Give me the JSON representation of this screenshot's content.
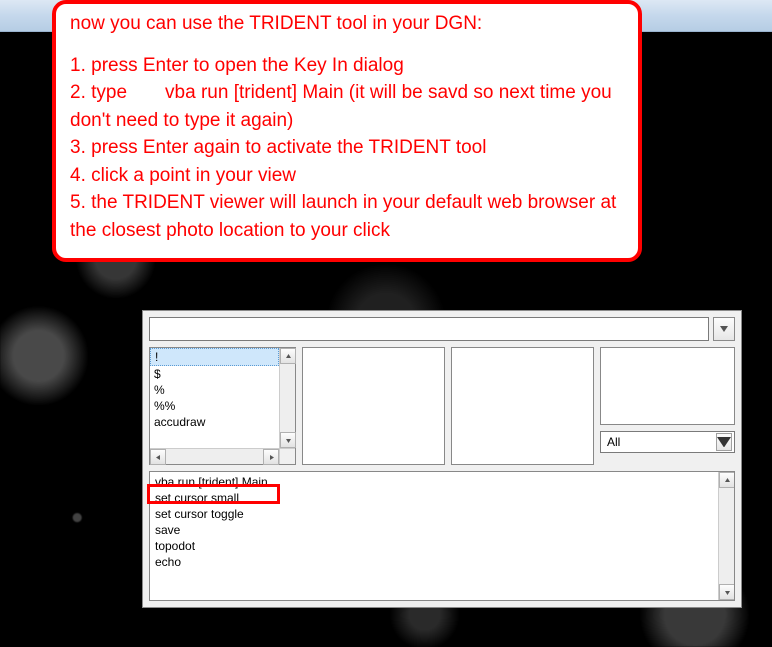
{
  "instructions": {
    "intro": "now you can use the TRIDENT tool in your DGN:",
    "steps": [
      "1. press Enter to open the Key In dialog",
      "2. type  vba run [trident] Main (it will be savd so next time you don't need to type it again)",
      "3. press Enter again to activate the TRIDENT tool",
      "4. click a point in your view",
      "5. the TRIDENT viewer will launch in your default web browser at the closest photo location to your click"
    ]
  },
  "keyin": {
    "input_value": "",
    "commands": [
      "!",
      "$",
      "%",
      "%%",
      "accudraw"
    ],
    "selected_command_index": 0,
    "filter_value": "All",
    "history": [
      "vba run [trident] Main",
      "set cursor small",
      "set cursor toggle",
      "save",
      "topodot",
      "echo"
    ],
    "highlighted_history_index": 0
  }
}
